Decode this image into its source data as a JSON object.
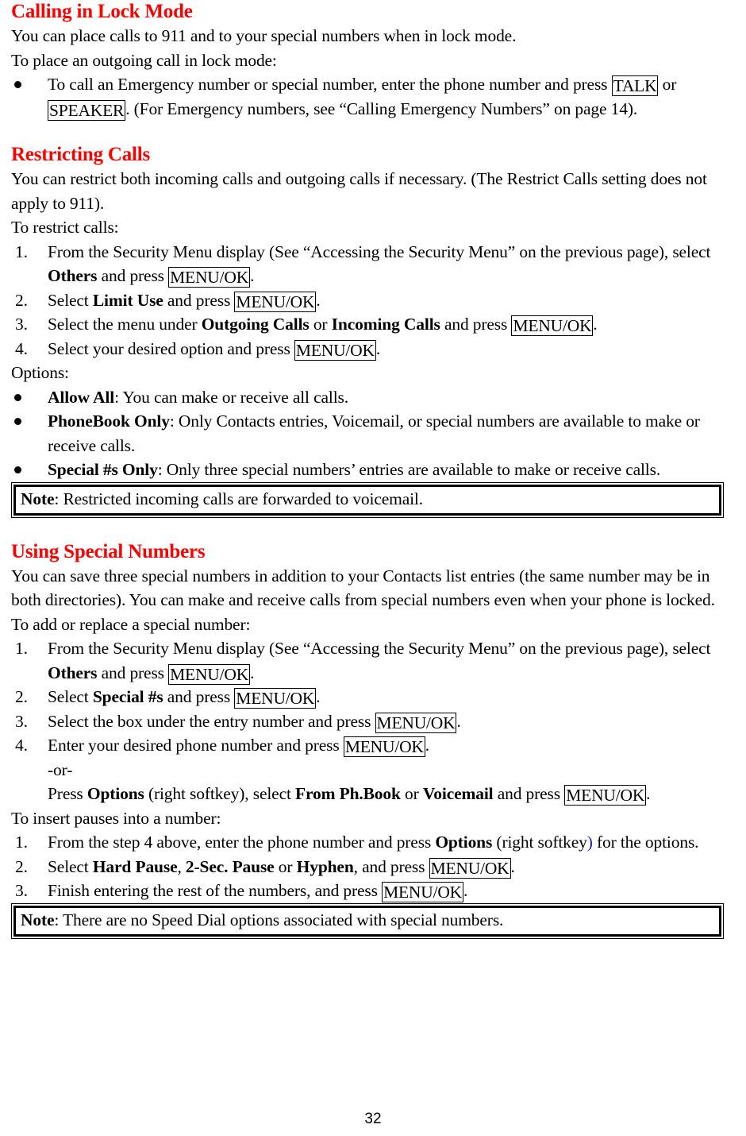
{
  "document": {
    "page_number": "32",
    "heading_color": "#FF0000",
    "sections": [
      {
        "id": "calling-in-lock-mode",
        "heading": "Calling in Lock Mode",
        "paragraphs": [
          "You can place calls to 911 and to your special numbers when in lock mode.",
          "To place an outgoing call in lock mode:"
        ],
        "bullets": [
          {
            "lead": "",
            "text_parts": [
              " To call an Emergency number or special number, enter the phone number and press ",
              "TALK",
              " or ",
              "SPEAKER",
              ". (For Emergency numbers, see “Calling Emergency Numbers” on page 14)."
            ]
          }
        ]
      },
      {
        "id": "restricting-calls",
        "heading": "Restricting Calls",
        "paragraphs": [
          "You can restrict both incoming calls and outgoing calls if necessary. (The Restrict Calls setting does not apply to 911).",
          "To restrict calls:"
        ],
        "steps": [
          {
            "number": "1.",
            "parts": [
              "From the Security Menu display (See “Accessing the Security Menu” on the previous page), select ",
              "Others",
              " and press ",
              "MENU/OK",
              "."
            ]
          },
          {
            "number": "2.",
            "parts": [
              "Select ",
              "Limit Use",
              " and press ",
              "MENU/OK",
              "."
            ]
          },
          {
            "number": "3.",
            "parts": [
              "Select the menu under ",
              "Outgoing Calls",
              " or ",
              "Incoming Calls",
              " and press ",
              "MENU/OK",
              "."
            ]
          },
          {
            "number": "4.",
            "parts": [
              "Select your desired option and press ",
              "MENU/OK",
              "."
            ]
          }
        ],
        "options_label": "Options:",
        "options": [
          {
            "term": "Allow All",
            "desc": ": You can make or receive all calls."
          },
          {
            "term": "PhoneBook Only",
            "desc": ": Only Contacts entries, Voicemail, or special numbers are available to make or receive calls."
          },
          {
            "term": "Special #s Only",
            "desc": ": Only three special numbers’ entries are available to make or receive calls."
          }
        ],
        "note": {
          "label": "Note",
          "text": ": Restricted incoming calls are forwarded to voicemail."
        }
      },
      {
        "id": "using-special-numbers",
        "heading": "Using Special Numbers",
        "paragraphs": [
          "You can save three special numbers in addition to your Contacts list entries (the same number may be in both directories). You can make and receive calls from special numbers even when your phone is locked.",
          "To add or replace a special number:"
        ],
        "steps": [
          {
            "number": "1.",
            "parts": [
              "From the Security Menu display (See “Accessing the Security Menu” on the previous page), select ",
              "Others",
              " and press ",
              "MENU/OK",
              "."
            ]
          },
          {
            "number": "2.",
            "parts": [
              "Select ",
              "Special #s",
              " and press ",
              "MENU/OK",
              "."
            ]
          },
          {
            "number": "3.",
            "parts": [
              "Select the box under the entry number and press ",
              "MENU/OK",
              "."
            ]
          },
          {
            "number": "4.",
            "parts": [
              "Enter your desired phone number and press ",
              "MENU/OK",
              "."
            ]
          }
        ],
        "or_divider": "-or-",
        "or_line": {
          "parts": [
            "Press ",
            "Options",
            " (right softkey), select ",
            "From Ph.Book",
            " or ",
            "Voicemail",
            " and press ",
            "MENU/OK",
            "."
          ]
        },
        "pauses_intro": "To insert pauses into a number:",
        "pause_steps": [
          {
            "number": "1.",
            "parts": [
              "From the step 4 above, enter the phone number and press ",
              "Options",
              " (right softkey",
              ")",
              " for the options."
            ]
          },
          {
            "number": "2.",
            "parts": [
              "Select ",
              "Hard Pause",
              ", ",
              "2-Sec. Pause",
              " or ",
              "Hyphen",
              ", and press ",
              "MENU/OK",
              "."
            ]
          },
          {
            "number": "3.",
            "parts": [
              "Finish entering the rest of the numbers, and press ",
              "MENU/OK",
              "."
            ]
          }
        ],
        "note": {
          "label": "Note",
          "text": ": There are no Speed Dial options associated with special numbers."
        }
      }
    ]
  }
}
